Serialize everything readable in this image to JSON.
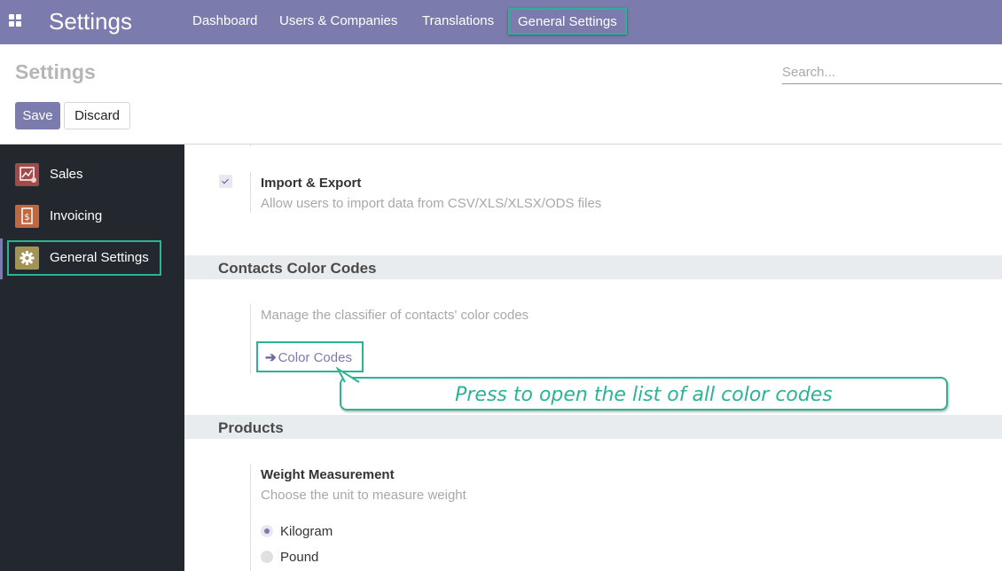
{
  "navbar": {
    "brand": "Settings",
    "items": [
      {
        "label": "Dashboard"
      },
      {
        "label": "Users & Companies"
      },
      {
        "label": "Translations"
      },
      {
        "label": "General Settings"
      }
    ]
  },
  "control_panel": {
    "title": "Settings",
    "search_placeholder": "Search...",
    "save_label": "Save",
    "discard_label": "Discard"
  },
  "sidebar": {
    "items": [
      {
        "label": "Sales",
        "icon": "sales-chart-icon",
        "color": "#a24a4a"
      },
      {
        "label": "Invoicing",
        "icon": "invoice-icon",
        "color": "#c0683f"
      },
      {
        "label": "General Settings",
        "icon": "gear-icon",
        "color": "#a29357"
      }
    ]
  },
  "main": {
    "import_export": {
      "title": "Import & Export",
      "description": "Allow users to import data from CSV/XLS/XLSX/ODS files",
      "checked": true
    },
    "contacts_color_codes": {
      "section_title": "Contacts Color Codes",
      "description": "Manage the classifier of contacts' color codes",
      "button_label": "Color Codes",
      "callout": "Press to open the list of all color codes"
    },
    "products": {
      "section_title": "Products",
      "weight_title": "Weight Measurement",
      "weight_description": "Choose the unit to measure weight",
      "options": [
        {
          "label": "Kilogram",
          "selected": true
        },
        {
          "label": "Pound",
          "selected": false
        }
      ]
    }
  },
  "colors": {
    "accent": "#7c7bad",
    "highlight": "#2bb395",
    "sidebar_bg": "#23272e"
  }
}
